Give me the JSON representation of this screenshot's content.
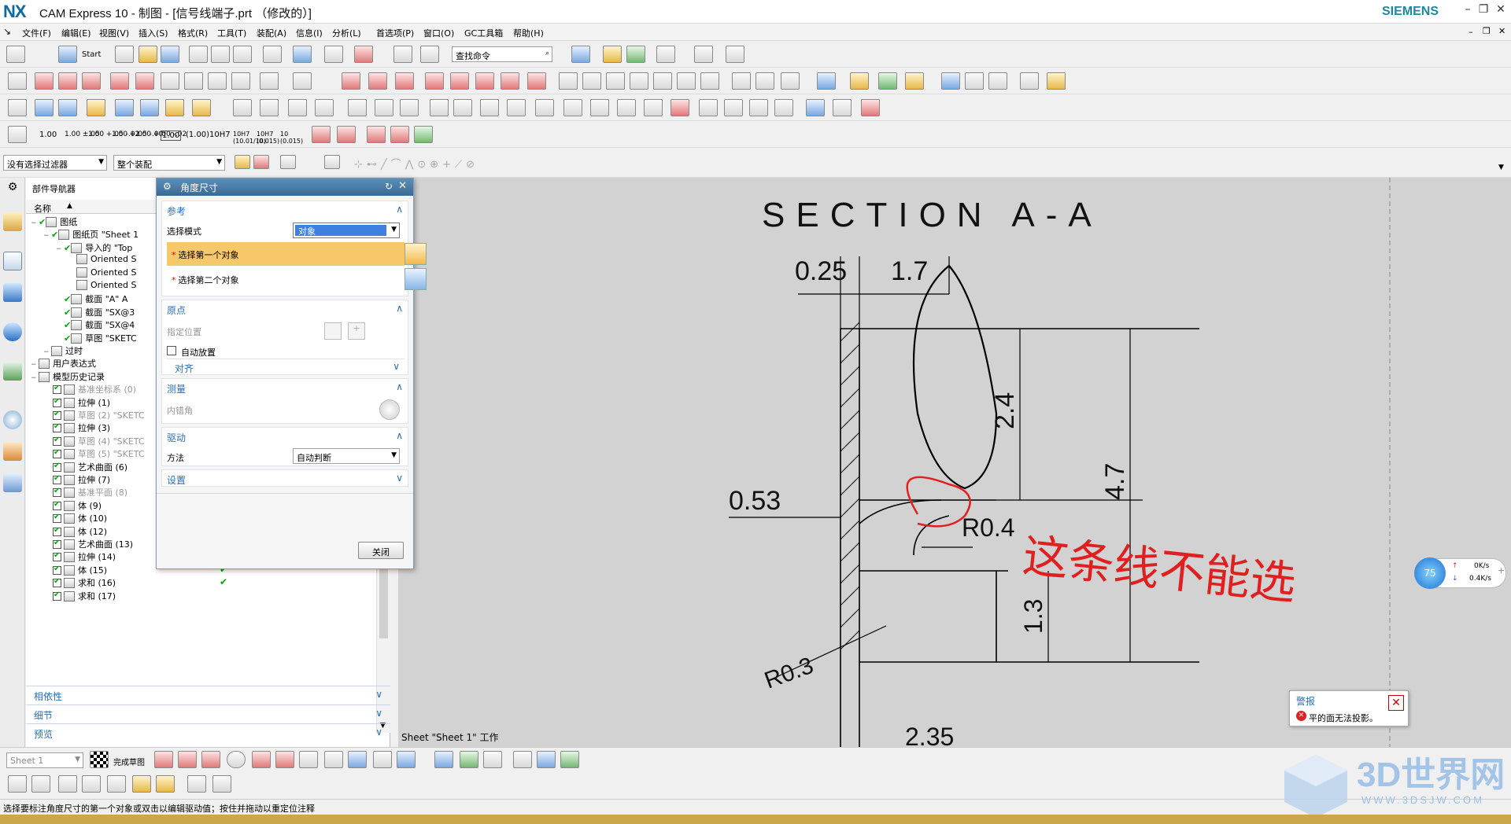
{
  "window": {
    "logo": "NX",
    "title": "CAM Express 10 - 制图 - [信号线端子.prt （修改的）]",
    "brand": "SIEMENS"
  },
  "menu": [
    "文件(F)",
    "编辑(E)",
    "视图(V)",
    "插入(S)",
    "格式(R)",
    "工具(T)",
    "装配(A)",
    "信息(I)",
    "分析(L)",
    "首选项(P)",
    "窗口(O)",
    "GC工具箱",
    "帮助(H)"
  ],
  "toolbar": {
    "start_label": "Start",
    "search_placeholder": "查找命令",
    "tol_labels": [
      "1.00",
      "1.00 ±.05",
      "1.00 +.05 -.02",
      "1.00 +.05 -.00",
      "1.00 +.00 -.02",
      "1.00",
      "(1.00)",
      "10H7",
      "10H7 (10.01/10)",
      "10H7 (0.015)",
      "10 (0.015)"
    ]
  },
  "filters": {
    "selection_filter": "没有选择过滤器",
    "scope": "整个装配"
  },
  "navigator": {
    "title": "部件导航器",
    "column_name": "名称",
    "rows": [
      {
        "text": "图纸",
        "indent": 0,
        "check": true,
        "gray": false
      },
      {
        "text": "图纸页 \"Sheet 1",
        "indent": 1,
        "check": true,
        "gray": false
      },
      {
        "text": "导入的 \"Top",
        "indent": 2,
        "check": true,
        "gray": false
      },
      {
        "text": "Oriented S",
        "indent": 3,
        "check": false,
        "gray": false
      },
      {
        "text": "Oriented S",
        "indent": 3,
        "check": false,
        "gray": false
      },
      {
        "text": "Oriented S",
        "indent": 3,
        "check": false,
        "gray": false
      },
      {
        "text": "截面 \"A\" A",
        "indent": 2,
        "check": true,
        "gray": false
      },
      {
        "text": "截面 \"SX@3",
        "indent": 2,
        "check": true,
        "gray": false
      },
      {
        "text": "截面 \"SX@4",
        "indent": 2,
        "check": true,
        "gray": false
      },
      {
        "text": "草图 \"SKETC",
        "indent": 2,
        "check": true,
        "gray": false
      },
      {
        "text": "过时",
        "indent": 1,
        "check": false,
        "gray": false
      },
      {
        "text": "用户表达式",
        "indent": 0,
        "check": false,
        "gray": false
      },
      {
        "text": "模型历史记录",
        "indent": 0,
        "check": false,
        "gray": false
      }
    ],
    "history": [
      {
        "text": "基准坐标系 (0)",
        "gray": true
      },
      {
        "text": "拉伸 (1)",
        "gray": false
      },
      {
        "text": "草图 (2) \"SKETC",
        "gray": true
      },
      {
        "text": "拉伸 (3)",
        "gray": false
      },
      {
        "text": "草图 (4) \"SKETC",
        "gray": true
      },
      {
        "text": "草图 (5) \"SKETC",
        "gray": true
      },
      {
        "text": "艺术曲面 (6)",
        "gray": false
      },
      {
        "text": "拉伸 (7)",
        "gray": false
      },
      {
        "text": "基准平面 (8)",
        "gray": true
      },
      {
        "text": "体 (9)",
        "gray": false
      },
      {
        "text": "体 (10)",
        "gray": false
      },
      {
        "text": "体 (12)",
        "gray": false
      },
      {
        "text": "艺术曲面 (13)",
        "gray": false
      },
      {
        "text": "拉伸 (14)",
        "gray": false
      },
      {
        "text": "体 (15)",
        "gray": false
      },
      {
        "text": "求和 (16)",
        "gray": false
      },
      {
        "text": "求和 (17)",
        "gray": false
      }
    ],
    "panels": [
      "相依性",
      "细节",
      "预览"
    ]
  },
  "dialog": {
    "title": "角度尺寸",
    "ref_section": "参考",
    "select_mode_label": "选择模式",
    "select_mode_value": "对象",
    "first_object": "选择第一个对象",
    "second_object": "选择第二个对象",
    "origin_section": "原点",
    "specify_location": "指定位置",
    "auto_place": "自动放置",
    "align": "对齐",
    "measure_section": "测量",
    "inner_angle": "内错角",
    "drive_section": "驱动",
    "method_label": "方法",
    "method_value": "自动判断",
    "settings_section": "设置",
    "close_button": "关闭"
  },
  "drawing": {
    "section_title": "SECTION  A-A",
    "dims": [
      "0.25",
      "1.7",
      "2.4",
      "4.7",
      "0.53",
      "R0.4",
      "R0.3",
      "1.3",
      "2.35"
    ],
    "sheet_label": "Sheet \"Sheet 1\" 工作",
    "handwriting": "这条线不能选"
  },
  "sketch_bar": {
    "sheet_combo": "Sheet 1",
    "finish_sketch": "完成草图"
  },
  "warning": {
    "title": "警报",
    "message": "平的面无法投影。"
  },
  "network": {
    "percent": "75",
    "up": "0K/s",
    "down": "0.4K/s"
  },
  "status": "选择要标注角度尺寸的第一个对象或双击以编辑驱动值；按住并拖动以重定位注释",
  "watermark": {
    "brand": "3D世界网",
    "url": "WWW.3DSJW.COM"
  },
  "colors": {
    "accent": "#2a6fb0",
    "dialog_header": "#3a6a94",
    "highlight_row": "#f7c86a",
    "select_blue": "#3f7fe0",
    "annotation_red": "#e02020"
  }
}
